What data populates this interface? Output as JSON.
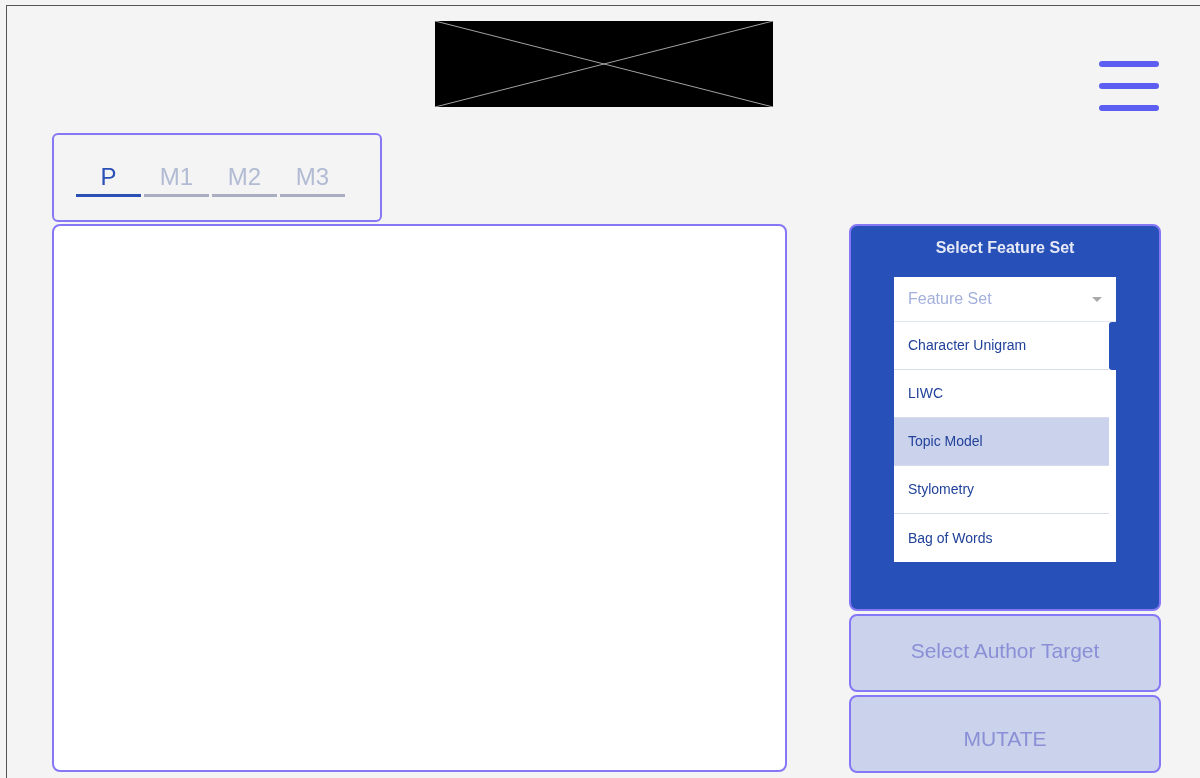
{
  "tabs": [
    {
      "label": "P",
      "selected": true
    },
    {
      "label": "M1",
      "selected": false
    },
    {
      "label": "M2",
      "selected": false
    },
    {
      "label": "M3",
      "selected": false
    }
  ],
  "feature_panel": {
    "title": "Select Feature Set",
    "dropdown": {
      "placeholder": "Feature Set",
      "options": [
        {
          "label": "Character Unigram",
          "selected": false
        },
        {
          "label": "LIWC",
          "selected": false
        },
        {
          "label": "Topic Model",
          "selected": true
        },
        {
          "label": "Stylometry",
          "selected": false
        },
        {
          "label": "Bag of Words",
          "selected": false
        }
      ]
    }
  },
  "buttons": [
    "Select Author Target",
    "MUTATE"
  ]
}
